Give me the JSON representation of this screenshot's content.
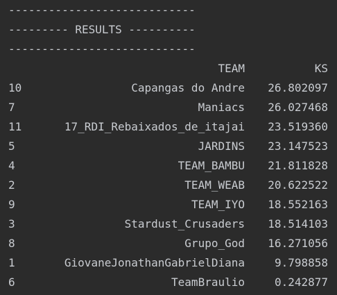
{
  "output": {
    "separator_top": "----------------------------",
    "results_banner": "--------- RESULTS ----------",
    "separator_bottom": "----------------------------",
    "columns": {
      "team_header": "TEAM",
      "ks_header": "KS"
    },
    "rows": [
      {
        "idx": "10",
        "team": "Capangas do Andre",
        "ks": "26.802097"
      },
      {
        "idx": "7",
        "team": "Maniacs",
        "ks": "26.027468"
      },
      {
        "idx": "11",
        "team": "17_RDI_Rebaixados_de_itajai",
        "ks": "23.519360"
      },
      {
        "idx": "5",
        "team": "JARDINS",
        "ks": "23.147523"
      },
      {
        "idx": "4",
        "team": "TEAM_BAMBU",
        "ks": "21.811828"
      },
      {
        "idx": "2",
        "team": "TEAM_WEAB",
        "ks": "20.622522"
      },
      {
        "idx": "9",
        "team": "TEAM_IYO",
        "ks": "18.552163"
      },
      {
        "idx": "3",
        "team": "Stardust_Crusaders",
        "ks": "18.514103"
      },
      {
        "idx": "8",
        "team": "Grupo_God",
        "ks": "16.271056"
      },
      {
        "idx": "1",
        "team": "GiovaneJonathanGabrielDiana",
        "ks": "9.798858"
      },
      {
        "idx": "6",
        "team": "TeamBraulio",
        "ks": "0.242877"
      }
    ]
  }
}
